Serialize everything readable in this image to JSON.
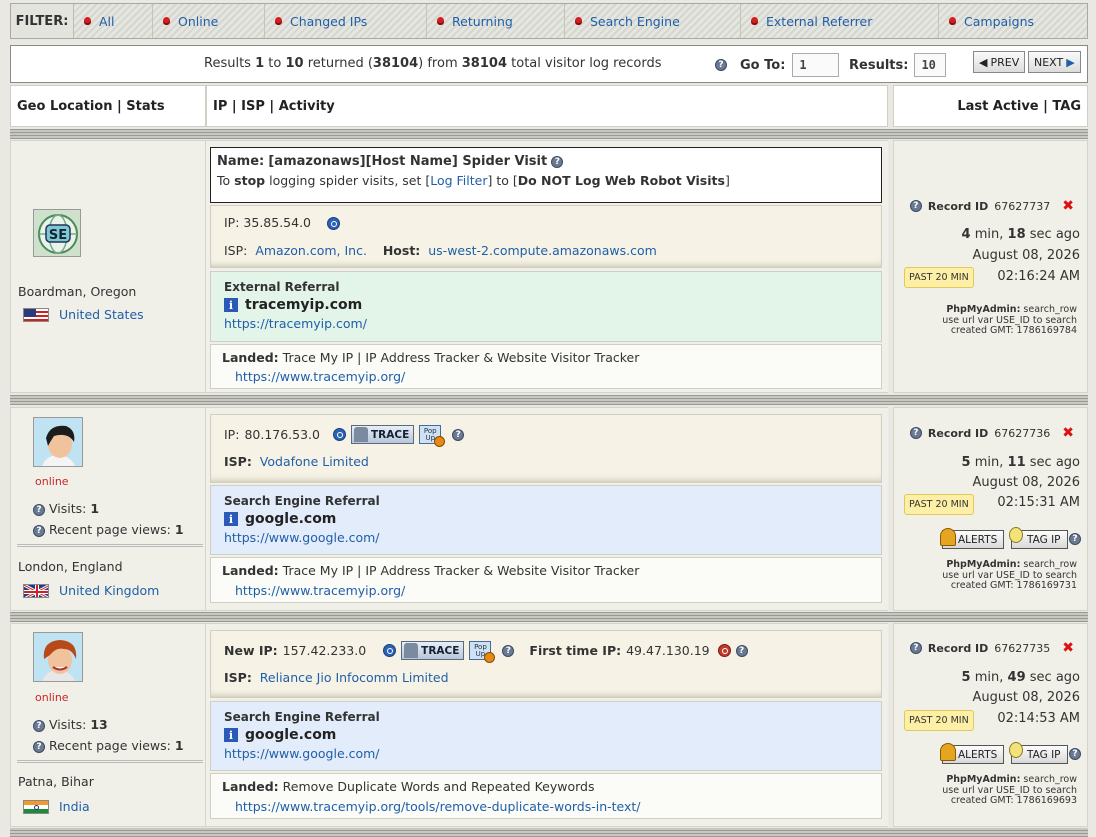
{
  "filter": {
    "label": "FILTER:",
    "items": [
      "All",
      "Online",
      "Changed IPs",
      "Returning",
      "Search Engine",
      "External Referrer",
      "Campaigns"
    ]
  },
  "results": {
    "prefix": "Results",
    "from_n": "1",
    "to_word": "to",
    "to_n": "10",
    "returned_word": "returned (",
    "returned_n": "38104",
    "from_word": ") from",
    "total_n": "38104",
    "suffix": "total visitor log records",
    "goto_label": "Go To:",
    "goto_value": "1",
    "results_label": "Results:",
    "results_value": "10",
    "prev_label": "PREV",
    "next_label": "NEXT"
  },
  "columns": {
    "geo": "Geo Location | Stats",
    "ip": "IP | ISP | Activity",
    "last": "Last Active | TAG"
  },
  "colors": {
    "accent": "#1f5fa8",
    "badge": "#fdf0a6",
    "delete": "#dd1111",
    "online": "#c62828"
  },
  "records": [
    {
      "avatar": "search-engine-spider-icon",
      "name_label": "Name:",
      "name_value": "[amazonaws][Host Name] Spider Visit",
      "spider_pre": "To",
      "spider_stop": "stop",
      "spider_mid": "logging spider visits, set [",
      "spider_link": "Log Filter",
      "spider_to": "] to [",
      "spider_opt": "Do NOT Log Web Robot Visits",
      "spider_end": "]",
      "ip_label": "IP:",
      "ip": "35.85.54.0",
      "isp_label": "ISP:",
      "isp": "Amazon.com, Inc.",
      "host_label": "Host:",
      "host": "us-west-2.compute.amazonaws.com",
      "ref_type": "External Referral",
      "ref_domain": "tracemyip.com",
      "ref_url": "https://tracemyip.com/",
      "landed_label": "Landed:",
      "landed_title": "Trace My IP | IP Address Tracker & Website Visitor Tracker",
      "landed_url": "https://www.tracemyip.org/",
      "city": "Boardman, Oregon",
      "country": "United States",
      "record_label": "Record ID",
      "record_id": "67627737",
      "ago_min": "4",
      "ago_sec": "18",
      "ago_min_word": "min,",
      "ago_sec_word": "sec ago",
      "date": "August 08, 2026",
      "badge": "PAST 20 MIN",
      "time": "02:16:24 AM",
      "php_label": "PhpMyAdmin:",
      "php_value": "search_row",
      "php_line2": "use url var USE_ID to search",
      "php_line3": "created GMT: 1786169784"
    },
    {
      "avatar": "male-avatar-dark-hair-icon",
      "online": "online",
      "visits_label": "Visits:",
      "visits": "1",
      "views_label": "Recent page views:",
      "views": "1",
      "ip_label": "IP:",
      "ip": "80.176.53.0",
      "trace_label": "TRACE",
      "popup_label": "Pop Up",
      "isp_label": "ISP:",
      "isp": "Vodafone Limited",
      "ref_type": "Search Engine Referral",
      "ref_domain": "google.com",
      "ref_url": "https://www.google.com/",
      "landed_label": "Landed:",
      "landed_title": "Trace My IP | IP Address Tracker & Website Visitor Tracker",
      "landed_url": "https://www.tracemyip.org/",
      "city": "London, England",
      "country": "United Kingdom",
      "record_label": "Record ID",
      "record_id": "67627736",
      "ago_min": "5",
      "ago_sec": "11",
      "ago_min_word": "min,",
      "ago_sec_word": "sec ago",
      "date": "August 08, 2026",
      "badge": "PAST 20 MIN",
      "time": "02:15:31 AM",
      "alerts_label": "ALERTS",
      "tagip_label": "TAG IP",
      "php_label": "PhpMyAdmin:",
      "php_value": "search_row",
      "php_line2": "use url var USE_ID to search",
      "php_line3": "created GMT: 1786169731"
    },
    {
      "avatar": "male-avatar-red-hair-icon",
      "online": "online",
      "visits_label": "Visits:",
      "visits": "13",
      "views_label": "Recent page views:",
      "views": "1",
      "ip_label": "New IP:",
      "ip": "157.42.233.0",
      "trace_label": "TRACE",
      "popup_label": "Pop Up",
      "first_label": "First time IP:",
      "first_ip": "49.47.130.19",
      "isp_label": "ISP:",
      "isp": "Reliance Jio Infocomm Limited",
      "ref_type": "Search Engine Referral",
      "ref_domain": "google.com",
      "ref_url": "https://www.google.com/",
      "landed_label": "Landed:",
      "landed_title": "Remove Duplicate Words and Repeated Keywords",
      "landed_url": "https://www.tracemyip.org/tools/remove-duplicate-words-in-text/",
      "city": "Patna, Bihar",
      "country": "India",
      "record_label": "Record ID",
      "record_id": "67627735",
      "ago_min": "5",
      "ago_sec": "49",
      "ago_min_word": "min,",
      "ago_sec_word": "sec ago",
      "date": "August 08, 2026",
      "badge": "PAST 20 MIN",
      "time": "02:14:53 AM",
      "alerts_label": "ALERTS",
      "tagip_label": "TAG IP",
      "php_label": "PhpMyAdmin:",
      "php_value": "search_row",
      "php_line2": "use url var USE_ID to search",
      "php_line3": "created GMT: 1786169693"
    }
  ]
}
